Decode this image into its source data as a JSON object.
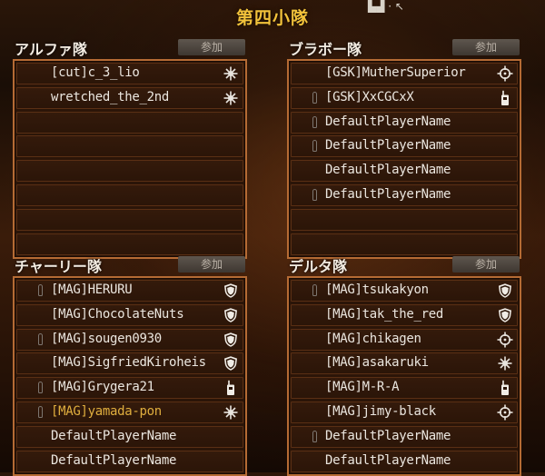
{
  "header": {
    "title": "第四小隊"
  },
  "join_label": "参加",
  "colors": {
    "title": "#f2c23b",
    "frame": "#b56b34",
    "highlight_name": "#e0ae3e"
  },
  "squads": [
    {
      "name": "アルファ隊",
      "slots": [
        {
          "player": "[cut]c_3_lio",
          "mic": false,
          "class": "support-icon",
          "highlight": false
        },
        {
          "player": "wretched_the_2nd",
          "mic": false,
          "class": "support-icon",
          "highlight": false
        },
        {
          "player": "",
          "mic": false,
          "class": "",
          "highlight": false
        },
        {
          "player": "",
          "mic": false,
          "class": "",
          "highlight": false
        },
        {
          "player": "",
          "mic": false,
          "class": "",
          "highlight": false
        },
        {
          "player": "",
          "mic": false,
          "class": "",
          "highlight": false
        },
        {
          "player": "",
          "mic": false,
          "class": "",
          "highlight": false
        },
        {
          "player": "",
          "mic": false,
          "class": "",
          "highlight": false
        }
      ]
    },
    {
      "name": "ブラボー隊",
      "slots": [
        {
          "player": "[GSK]MutherSuperior",
          "mic": false,
          "class": "crosshair-icon",
          "highlight": false
        },
        {
          "player": "[GSK]XxCGCxX",
          "mic": true,
          "class": "radio-icon",
          "highlight": false
        },
        {
          "player": "DefaultPlayerName",
          "mic": true,
          "class": "",
          "highlight": false
        },
        {
          "player": "DefaultPlayerName",
          "mic": true,
          "class": "",
          "highlight": false
        },
        {
          "player": "DefaultPlayerName",
          "mic": false,
          "class": "",
          "highlight": false
        },
        {
          "player": "DefaultPlayerName",
          "mic": true,
          "class": "",
          "highlight": false
        },
        {
          "player": "",
          "mic": false,
          "class": "",
          "highlight": false
        },
        {
          "player": "",
          "mic": false,
          "class": "",
          "highlight": false
        }
      ]
    },
    {
      "name": "チャーリー隊",
      "slots": [
        {
          "player": "[MAG]HERURU",
          "mic": true,
          "class": "shield-icon",
          "highlight": false
        },
        {
          "player": "[MAG]ChocolateNuts",
          "mic": false,
          "class": "shield-icon",
          "highlight": false
        },
        {
          "player": "[MAG]sougen0930",
          "mic": true,
          "class": "shield-icon",
          "highlight": false
        },
        {
          "player": "[MAG]SigfriedKiroheis",
          "mic": false,
          "class": "shield-icon",
          "highlight": false
        },
        {
          "player": "[MAG]Grygera21",
          "mic": true,
          "class": "radio-icon",
          "highlight": false
        },
        {
          "player": "[MAG]yamada-pon",
          "mic": true,
          "class": "support-icon",
          "highlight": true
        },
        {
          "player": "DefaultPlayerName",
          "mic": false,
          "class": "",
          "highlight": false
        },
        {
          "player": "DefaultPlayerName",
          "mic": false,
          "class": "",
          "highlight": false
        }
      ]
    },
    {
      "name": "デルタ隊",
      "slots": [
        {
          "player": "[MAG]tsukakyon",
          "mic": true,
          "class": "shield-icon",
          "highlight": false
        },
        {
          "player": "[MAG]tak_the_red",
          "mic": false,
          "class": "shield-icon",
          "highlight": false
        },
        {
          "player": "[MAG]chikagen",
          "mic": false,
          "class": "crosshair-icon",
          "highlight": false
        },
        {
          "player": "[MAG]asakaruki",
          "mic": false,
          "class": "support-icon",
          "highlight": false
        },
        {
          "player": "[MAG]M-R-A",
          "mic": false,
          "class": "radio-icon",
          "highlight": false
        },
        {
          "player": "[MAG]jimy-black",
          "mic": false,
          "class": "crosshair-icon",
          "highlight": false
        },
        {
          "player": "DefaultPlayerName",
          "mic": true,
          "class": "",
          "highlight": false
        },
        {
          "player": "DefaultPlayerName",
          "mic": false,
          "class": "",
          "highlight": false
        }
      ]
    }
  ]
}
